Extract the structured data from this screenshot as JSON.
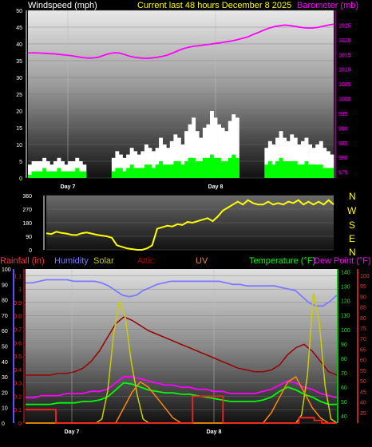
{
  "header": {
    "windspeed_label": "Windspeed (mph)",
    "title": "Current last 48 hours December 8 2025",
    "barometer_label": "Barometer (mb)"
  },
  "legend2": {
    "rainfall": "Rainfall (in)",
    "humidity": "Humidity",
    "solar": "Solar",
    "attic": "Attic",
    "uv": "UV",
    "temperature": "Temperature (°F)",
    "dewpoint": "Dew Point (°F)"
  },
  "compass": [
    "N",
    "W",
    "S",
    "E",
    "N"
  ],
  "colors": {
    "wind_gust": "#ffffff",
    "wind_avg": "#00ff00",
    "barometer": "#ff00ff",
    "direction": "#ffff00",
    "rainfall": "#ff2020",
    "humidity": "#7b7bff",
    "solar": "#cccc00",
    "attic": "#990000",
    "uv": "#ff8800",
    "temperature": "#00ff00",
    "dewpoint": "#ff00ff",
    "axis_left": "#5555ff",
    "axis_right_green": "#00ff00",
    "axis_right_red": "#ff3333"
  },
  "chart_data": [
    {
      "type": "area",
      "name": "wind_barometer",
      "x_label_days": [
        "Day 7",
        "Day 8"
      ],
      "y_left_ticks": [
        0,
        5,
        10,
        15,
        20,
        25,
        30,
        35,
        40,
        45,
        50
      ],
      "y_left_range": [
        0,
        50
      ],
      "y_right_ticks": [
        975,
        980,
        985,
        990,
        995,
        1000,
        1005,
        1010,
        1015,
        1020,
        1025
      ],
      "y_right_range": [
        973,
        1030
      ],
      "series": [
        {
          "role": "wind_gust",
          "values": [
            4,
            5,
            5,
            5,
            6,
            5,
            4,
            5,
            6,
            5,
            4,
            5,
            5,
            6,
            5,
            4,
            0,
            0,
            0,
            0,
            0,
            0,
            0,
            6,
            8,
            7,
            6,
            7,
            9,
            8,
            7,
            8,
            10,
            9,
            8,
            9,
            12,
            10,
            9,
            11,
            13,
            12,
            10,
            14,
            16,
            18,
            14,
            12,
            15,
            16,
            20,
            18,
            16,
            15,
            14,
            17,
            19,
            18,
            0,
            0,
            0,
            0,
            0,
            0,
            0,
            9,
            11,
            10,
            12,
            14,
            12,
            11,
            13,
            12,
            10,
            11,
            12,
            10,
            9,
            10,
            11,
            9,
            8,
            7
          ]
        },
        {
          "role": "wind_avg",
          "values": [
            1,
            2,
            2,
            2,
            3,
            2,
            2,
            2,
            3,
            2,
            2,
            2,
            2,
            3,
            2,
            2,
            0,
            0,
            0,
            0,
            0,
            0,
            0,
            2,
            3,
            3,
            2,
            3,
            4,
            3,
            3,
            3,
            4,
            4,
            3,
            4,
            5,
            4,
            4,
            4,
            5,
            5,
            4,
            5,
            6,
            6,
            5,
            5,
            6,
            6,
            7,
            6,
            6,
            5,
            5,
            6,
            7,
            6,
            0,
            0,
            0,
            0,
            0,
            0,
            0,
            4,
            5,
            4,
            5,
            6,
            5,
            5,
            5,
            5,
            4,
            4,
            5,
            4,
            4,
            4,
            4,
            3,
            3,
            3
          ]
        },
        {
          "role": "barometer",
          "values": [
            1015.5,
            1015.6,
            1015.5,
            1015.4,
            1015.3,
            1015.2,
            1015.0,
            1014.8,
            1014.6,
            1014.3,
            1014.0,
            1013.8,
            1013.8,
            1014.0,
            1014.6,
            1015.2,
            1015.6,
            1015.5,
            1015.0,
            1014.4,
            1014.0,
            1013.8,
            1013.7,
            1013.8,
            1014.0,
            1014.3,
            1014.8,
            1015.5,
            1016.3,
            1017.0,
            1017.5,
            1017.8,
            1018.0,
            1018.3,
            1018.5,
            1018.8,
            1019.0,
            1019.3,
            1019.6,
            1020.0,
            1020.5,
            1021.0,
            1021.8,
            1022.5,
            1023.3,
            1024.0,
            1024.5,
            1024.8,
            1025.0,
            1024.8,
            1024.5,
            1024.2,
            1024.0,
            1024.0,
            1024.2,
            1024.6,
            1025.0,
            1025.3
          ]
        }
      ]
    },
    {
      "type": "line",
      "name": "wind_direction",
      "y_ticks": [
        0,
        90,
        180,
        270,
        360
      ],
      "y_range": [
        0,
        360
      ],
      "values": [
        110,
        105,
        120,
        112,
        108,
        100,
        98,
        110,
        115,
        108,
        100,
        95,
        90,
        80,
        30,
        20,
        10,
        5,
        0,
        0,
        10,
        30,
        140,
        150,
        160,
        155,
        170,
        165,
        185,
        180,
        190,
        200,
        210,
        190,
        220,
        260,
        280,
        300,
        320,
        300,
        330,
        310,
        300,
        300,
        320,
        300,
        310,
        300,
        320,
        310,
        330,
        300,
        320,
        300,
        320,
        300,
        330,
        300
      ]
    },
    {
      "type": "line",
      "name": "weather_multi",
      "x_label_days": [
        "Day 7",
        "Day 8"
      ],
      "left_ticks_pct": [
        0,
        10,
        20,
        30,
        40,
        50,
        60,
        70,
        80,
        90,
        100
      ],
      "left_ticks_in": [
        0,
        0.1,
        0.2,
        0.3,
        0.4,
        0.5,
        0.6,
        0.7,
        0.8,
        0.9,
        1,
        1.1
      ],
      "right_ticks_temp": [
        40,
        50,
        60,
        70,
        80,
        90,
        100,
        110,
        120,
        130,
        140
      ],
      "right_ticks_dew": [
        35,
        40,
        45,
        50,
        55,
        60,
        65,
        70,
        75,
        80,
        85,
        90,
        95,
        100
      ],
      "series": [
        {
          "name": "Humidity",
          "unit": "%",
          "values": [
            91,
            91,
            92,
            93,
            93,
            93,
            93,
            92,
            92,
            92,
            92,
            91,
            89,
            86,
            83,
            82,
            83,
            86,
            88,
            90,
            91,
            92,
            92,
            92,
            92,
            92,
            92,
            92,
            92,
            91,
            90,
            90,
            89,
            89,
            89,
            89,
            89,
            88,
            87,
            86,
            82,
            78,
            76,
            76,
            79,
            83
          ]
        },
        {
          "name": "Temperature",
          "unit": "°F",
          "values": [
            48,
            48,
            48,
            48,
            49,
            49,
            49,
            50,
            50,
            51,
            53,
            58,
            63,
            62,
            60,
            58,
            57,
            56,
            56,
            55,
            55,
            54,
            53,
            52,
            51,
            50,
            50,
            50,
            50,
            51,
            53,
            57,
            60,
            58,
            55,
            53,
            50,
            48,
            48
          ]
        },
        {
          "name": "Dew Point",
          "unit": "°F",
          "values": [
            42,
            42,
            43,
            43,
            43,
            44,
            44,
            44,
            45,
            45,
            46,
            49,
            52,
            52,
            51,
            50,
            49,
            48,
            48,
            47,
            47,
            46,
            46,
            45,
            45,
            44,
            44,
            44,
            44,
            45,
            46,
            48,
            50,
            49,
            47,
            46,
            44,
            43,
            42
          ]
        },
        {
          "name": "Attic",
          "unit": "°F",
          "values": [
            58,
            58,
            58,
            58,
            59,
            59,
            60,
            62,
            66,
            72,
            80,
            88,
            92,
            90,
            87,
            84,
            82,
            80,
            78,
            76,
            74,
            72,
            70,
            68,
            66,
            64,
            62,
            61,
            60,
            60,
            61,
            64,
            70,
            74,
            76,
            72,
            66,
            60,
            58
          ]
        },
        {
          "name": "UV",
          "unit": "index",
          "values": [
            0,
            0,
            0,
            0,
            0,
            0,
            0,
            0,
            0,
            0,
            0,
            0,
            0.3,
            0.6,
            0.8,
            0.7,
            0.5,
            0.3,
            0.1,
            0,
            0,
            0,
            0,
            0,
            0,
            0,
            0,
            0,
            0,
            0,
            0.2,
            0.5,
            0.8,
            0.9,
            0.6,
            0.3,
            0.1,
            0,
            0
          ]
        },
        {
          "name": "Solar",
          "unit": "W/m²",
          "values": [
            0,
            0,
            0,
            0,
            0,
            0,
            0,
            0,
            0,
            0,
            0,
            0,
            0,
            10,
            80,
            220,
            300,
            260,
            150,
            70,
            10,
            0,
            0,
            0,
            0,
            0,
            0,
            0,
            0,
            0,
            0,
            0,
            0,
            0,
            0,
            0,
            0,
            0,
            0,
            0,
            0,
            0,
            0,
            0,
            0,
            0,
            0,
            20,
            120,
            320,
            250,
            90,
            10,
            0
          ]
        },
        {
          "name": "Rainfall",
          "unit": "in",
          "values": [
            0.1,
            0.1,
            0.1,
            0.1,
            0,
            0,
            0,
            0,
            0,
            0,
            0,
            0,
            0,
            0,
            0,
            0,
            0,
            0,
            0,
            0,
            0,
            0,
            0.2,
            0.2,
            0.2,
            0.2,
            0,
            0,
            0,
            0,
            0,
            0,
            0,
            0,
            0,
            0,
            0.04,
            0.04,
            0.02,
            0,
            0
          ]
        }
      ]
    }
  ]
}
